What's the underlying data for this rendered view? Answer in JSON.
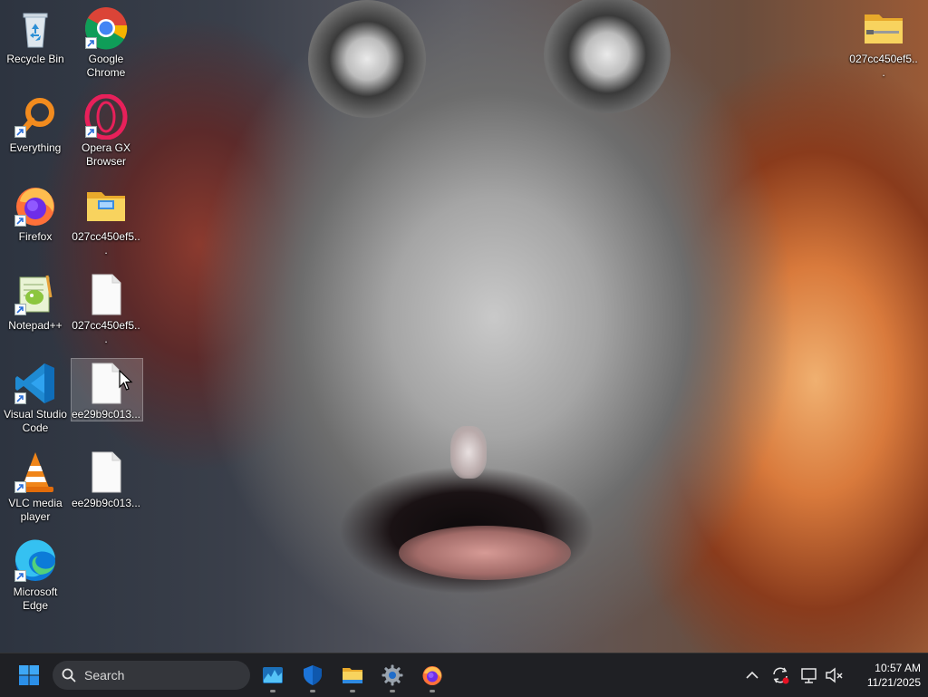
{
  "desktop": {
    "icons": [
      {
        "label": "Recycle Bin",
        "icon": "recycle-bin-icon"
      },
      {
        "label": "Google Chrome",
        "icon": "chrome-icon"
      },
      {
        "label": "Everything",
        "icon": "everything-search-icon"
      },
      {
        "label": "Opera GX Browser",
        "icon": "opera-gx-icon"
      },
      {
        "label": "Firefox",
        "icon": "firefox-icon"
      },
      {
        "label": "027cc450ef5...",
        "icon": "folder-icon"
      },
      {
        "label": "Notepad++",
        "icon": "notepad-plus-plus-icon"
      },
      {
        "label": "027cc450ef5...",
        "icon": "file-icon"
      },
      {
        "label": "Visual Studio Code",
        "icon": "vscode-icon"
      },
      {
        "label": "ee29b9c013...",
        "icon": "file-icon"
      },
      {
        "label": "VLC media player",
        "icon": "vlc-icon"
      },
      {
        "label": "ee29b9c013...",
        "icon": "file-icon"
      },
      {
        "label": "Microsoft Edge",
        "icon": "edge-icon"
      },
      {
        "label": "027cc450ef5...",
        "icon": "zip-folder-icon"
      }
    ]
  },
  "taskbar": {
    "search_placeholder": "Search",
    "pinned": [
      {
        "name": "task-manager",
        "icon": "task-manager-icon"
      },
      {
        "name": "windows-security",
        "icon": "shield-icon"
      },
      {
        "name": "file-explorer",
        "icon": "folder-icon"
      },
      {
        "name": "settings",
        "icon": "gear-icon"
      },
      {
        "name": "firefox",
        "icon": "firefox-icon"
      }
    ],
    "tray": {
      "time": "10:57 AM",
      "date": "11/21/2025"
    }
  },
  "colors": {
    "taskbar_bg": "#1f2024",
    "start_blue": "#2b8fe8",
    "accent": "#3d9be9"
  }
}
